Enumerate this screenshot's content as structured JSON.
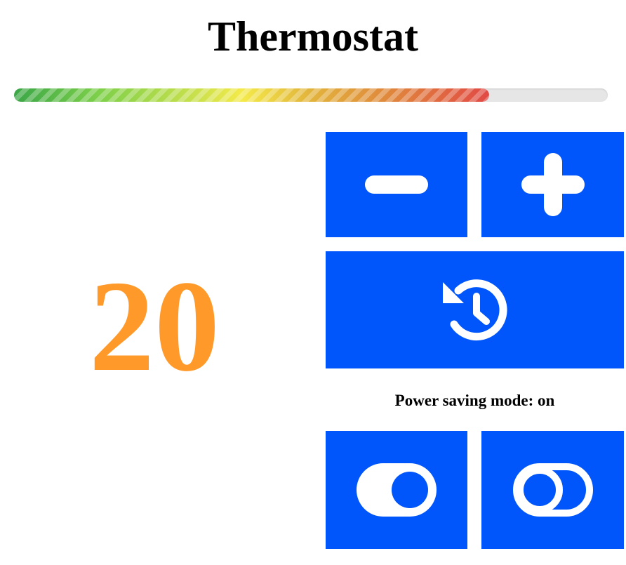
{
  "header": {
    "title": "Thermostat"
  },
  "temperature_gauge": {
    "fill_fraction": 0.8,
    "gradient_colors": [
      "#3aa647",
      "#7ed04a",
      "#f4ea4a",
      "#e08a3c",
      "#e14a45"
    ],
    "track_color": "#e6e6e6"
  },
  "display": {
    "temperature": "20",
    "temperature_color": "#ff9a2a"
  },
  "controls": {
    "decrease_icon": "minus-icon",
    "increase_icon": "plus-icon",
    "reset_icon": "history-icon",
    "power_on_icon": "toggle-on-icon",
    "power_off_icon": "toggle-off-icon",
    "button_color": "#0056fb"
  },
  "status": {
    "power_saving_text": "Power saving mode: on"
  }
}
